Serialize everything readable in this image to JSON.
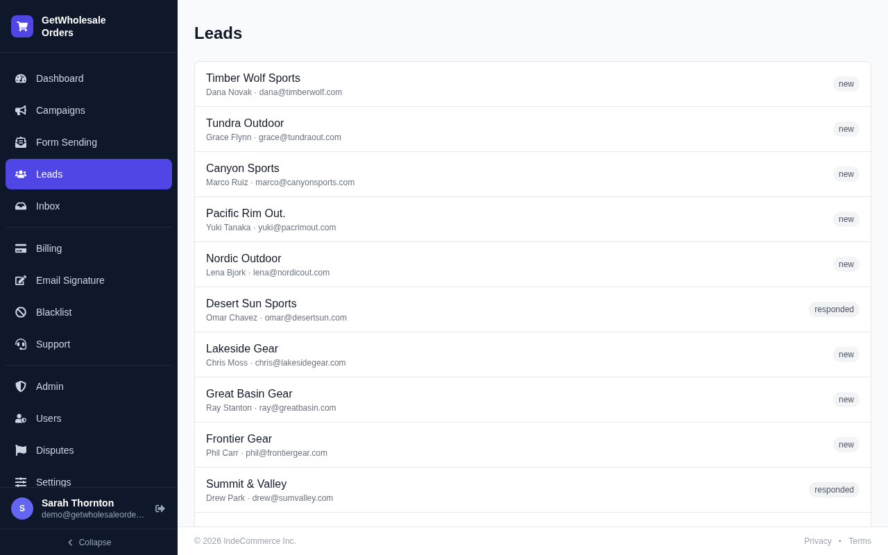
{
  "sidebar": {
    "brand": {
      "name": "GetWholesale Orders"
    },
    "sections": [
      {
        "items": [
          {
            "label": "Dashboard",
            "selected": false
          },
          {
            "label": "Campaigns",
            "selected": false
          },
          {
            "label": "Form Sending",
            "selected": false
          },
          {
            "label": "Leads",
            "selected": true
          },
          {
            "label": "Inbox",
            "selected": false
          }
        ]
      },
      {
        "items": [
          {
            "label": "Billing",
            "selected": false
          },
          {
            "label": "Email Signature",
            "selected": false
          },
          {
            "label": "Blacklist",
            "selected": false
          },
          {
            "label": "Support",
            "selected": false
          }
        ]
      },
      {
        "items": [
          {
            "label": "Admin",
            "selected": false
          },
          {
            "label": "Users",
            "selected": false
          },
          {
            "label": "Disputes",
            "selected": false
          },
          {
            "label": "Settings",
            "selected": false
          }
        ]
      }
    ],
    "user": {
      "initial": "S",
      "name": "Sarah Thornton",
      "email": "demo@getwholesaleorde…"
    },
    "collapse_label": "Collapse"
  },
  "page": {
    "title": "Leads",
    "leads": [
      {
        "company": "Timber Wolf Sports",
        "detail": "Dana Novak · dana@timberwolf.com",
        "status": "new"
      },
      {
        "company": "Tundra Outdoor",
        "detail": "Grace Flynn · grace@tundraout.com",
        "status": "new"
      },
      {
        "company": "Canyon Sports",
        "detail": "Marco Ruiz · marco@canyonsports.com",
        "status": "new"
      },
      {
        "company": "Pacific Rim Out.",
        "detail": "Yuki Tanaka · yuki@pacrimout.com",
        "status": "new"
      },
      {
        "company": "Nordic Outdoor",
        "detail": "Lena Bjork · lena@nordicout.com",
        "status": "new"
      },
      {
        "company": "Desert Sun Sports",
        "detail": "Omar Chavez · omar@desertsun.com",
        "status": "responded"
      },
      {
        "company": "Lakeside Gear",
        "detail": "Chris Moss · chris@lakesidegear.com",
        "status": "new"
      },
      {
        "company": "Great Basin Gear",
        "detail": "Ray Stanton · ray@greatbasin.com",
        "status": "new"
      },
      {
        "company": "Frontier Gear",
        "detail": "Phil Carr · phil@frontiergear.com",
        "status": "new"
      },
      {
        "company": "Summit & Valley",
        "detail": "Drew Park · drew@sumvalley.com",
        "status": "responded"
      }
    ]
  },
  "footer": {
    "copyright": "© 2026 IndeCommerce Inc.",
    "links": [
      "Privacy",
      "Terms"
    ],
    "separator": "·"
  }
}
